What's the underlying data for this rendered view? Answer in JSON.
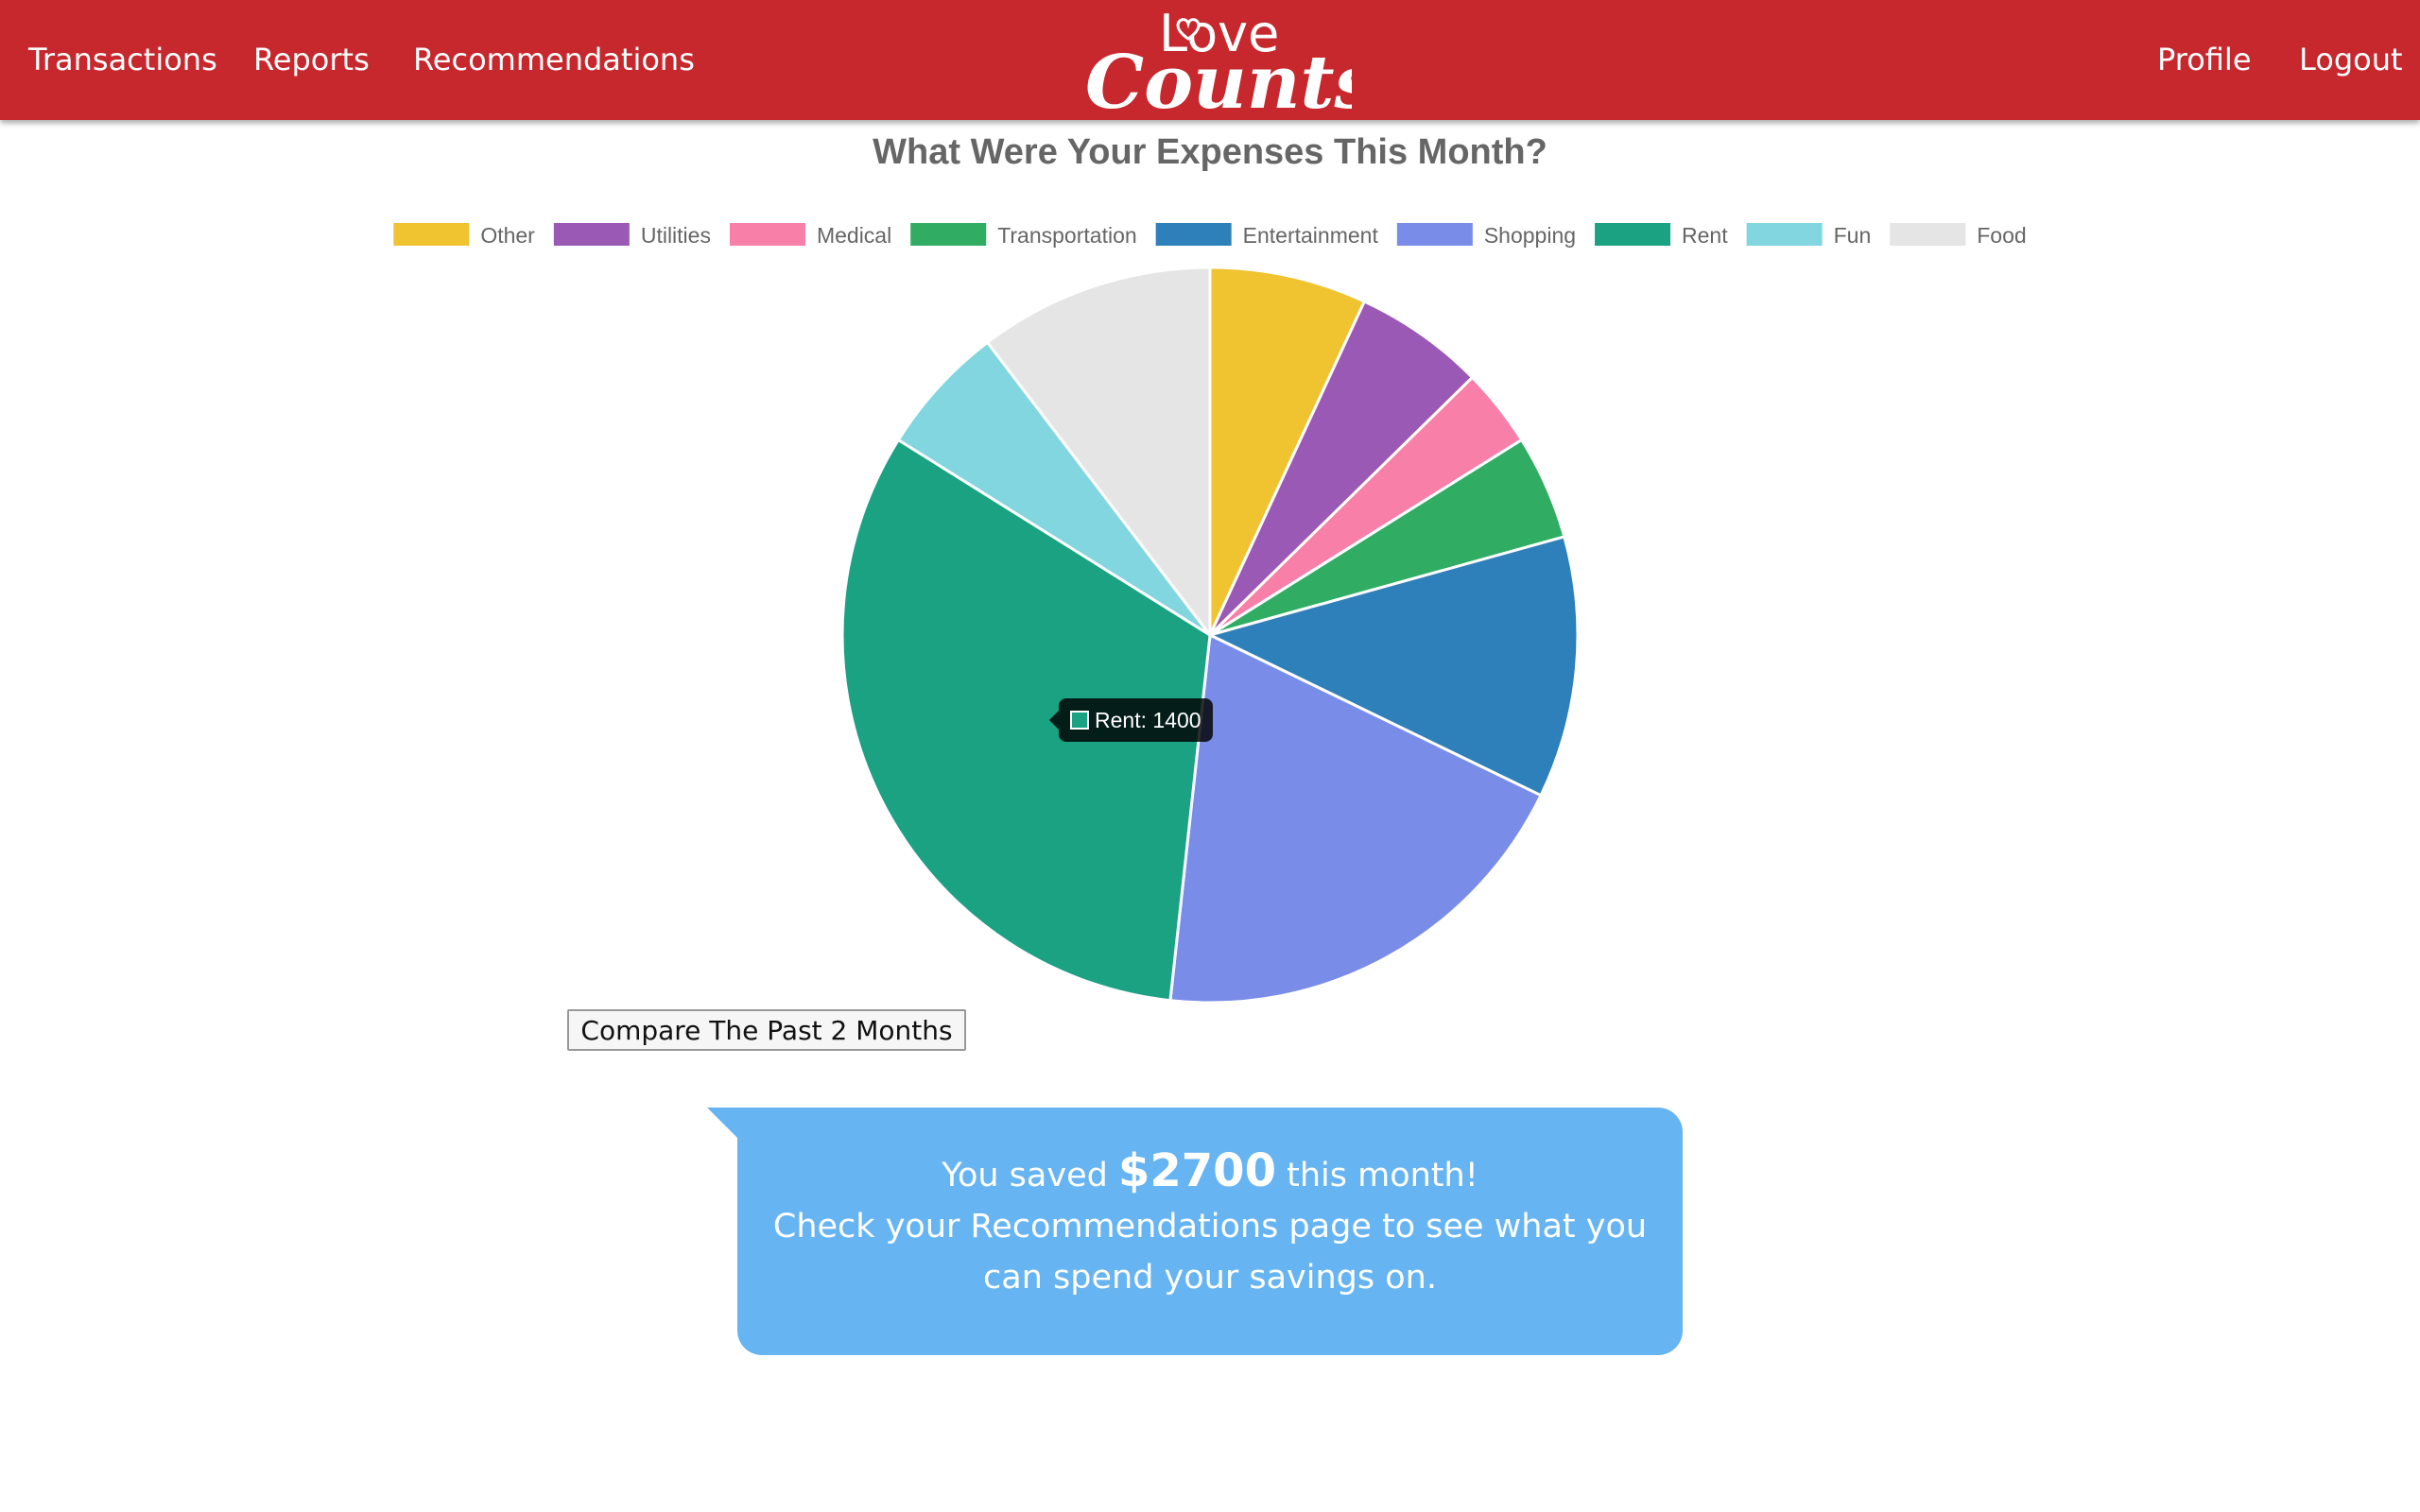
{
  "nav": {
    "left": [
      "Transactions",
      "Reports",
      "Recommendations"
    ],
    "right": [
      "Profile",
      "Logout"
    ],
    "logo_top": "Love",
    "logo_bottom": "Counts"
  },
  "colors": {
    "navbar": "#c6282e",
    "bubble": "#67b4f2"
  },
  "chart_data": {
    "type": "pie",
    "title": "What Were Your Expenses This Month?",
    "legend_position": "top",
    "categories": [
      "Other",
      "Utilities",
      "Medical",
      "Transportation",
      "Entertainment",
      "Shopping",
      "Rent",
      "Fun",
      "Food"
    ],
    "values": [
      300,
      250,
      150,
      200,
      500,
      850,
      1400,
      250,
      450
    ],
    "colors": [
      "#f0c330",
      "#9b59b6",
      "#f77fa8",
      "#30ad63",
      "#2e80ba",
      "#798de8",
      "#1aa283",
      "#81d6df",
      "#e5e5e5"
    ],
    "tooltip": {
      "label": "Rent: 1400",
      "category": "Rent"
    }
  },
  "compare_button": "Compare The Past 2 Months",
  "savings": {
    "prefix": "You saved",
    "amount": "$2700",
    "suffix": "this month!",
    "line2": "Check your Recommendations page to see what you",
    "line3": "can spend your savings on."
  }
}
